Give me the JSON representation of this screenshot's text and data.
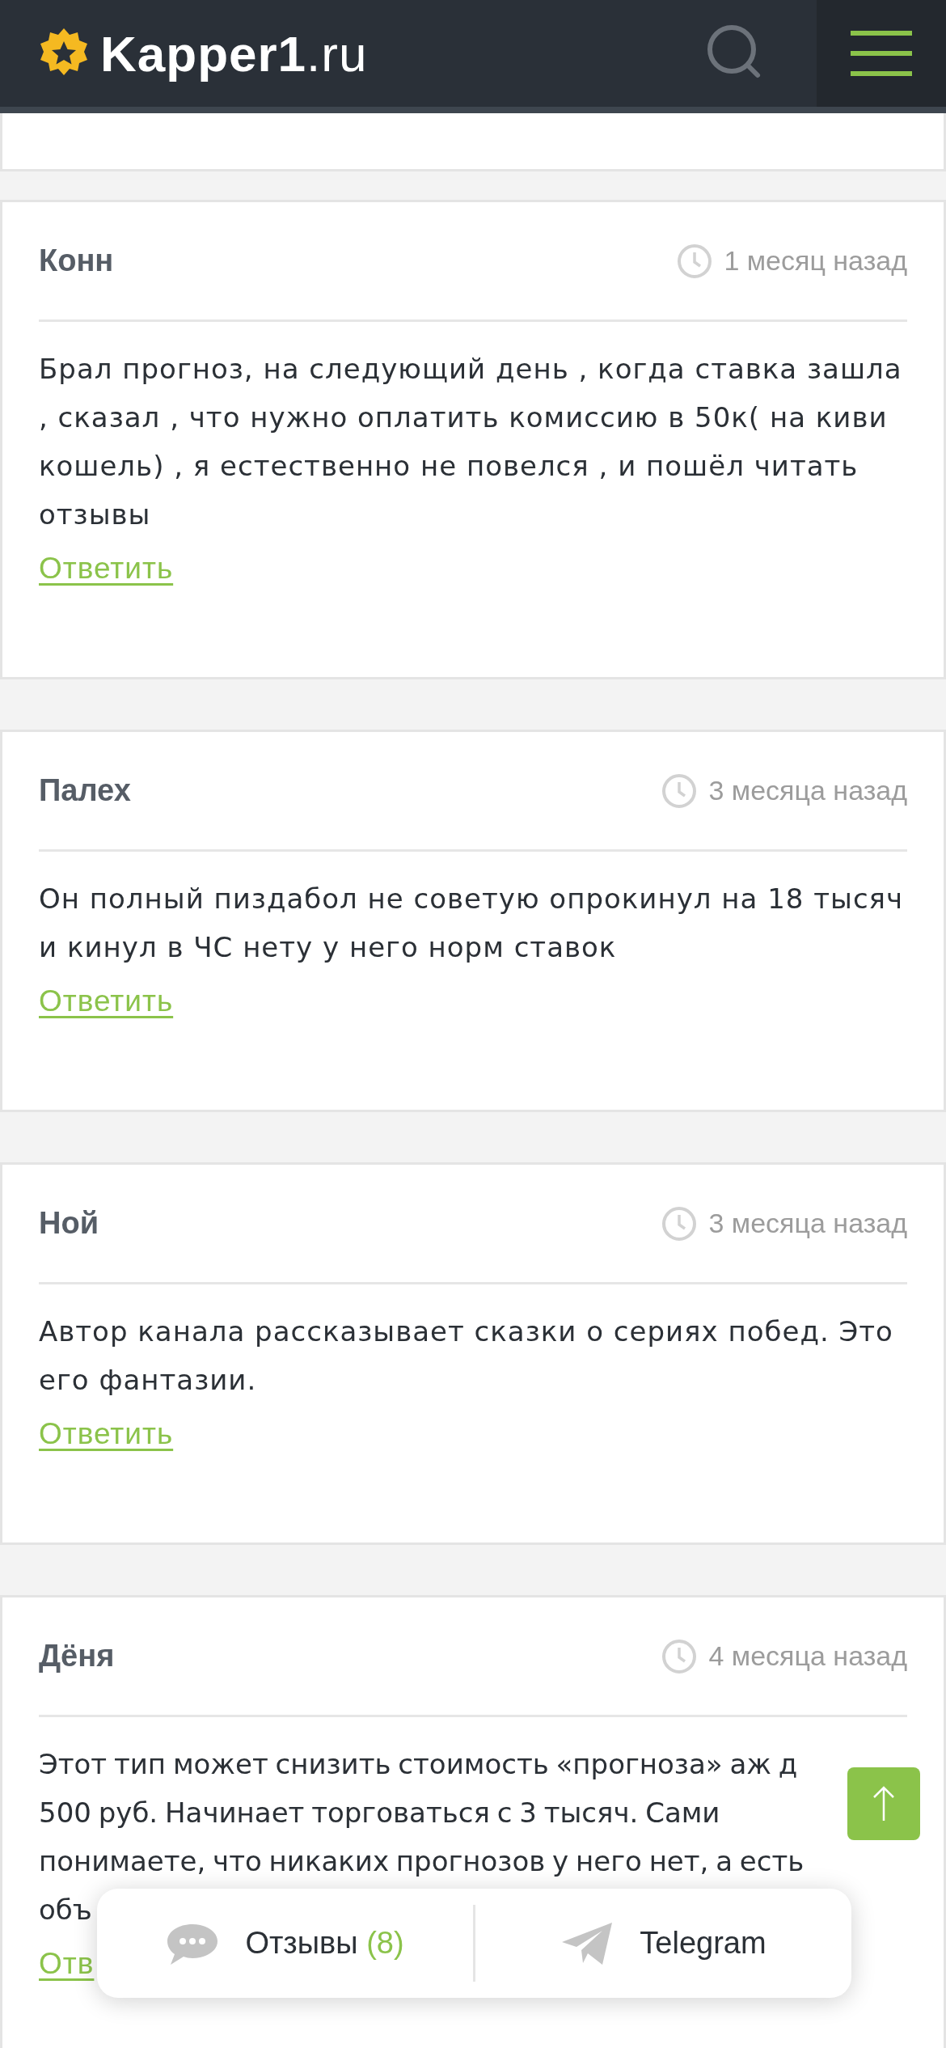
{
  "header": {
    "logo": "**Kapper1**.ru"
  },
  "comments": [
    {
      "kind": "partial"
    },
    {
      "kind": "full",
      "author": "Конн",
      "time": "1 месяц назад",
      "text": "Брал прогноз, на следующий день , когда ставка зашла , сказал , что нужно оплатить комиссию в 50к( на киви кошель) , я естественно не повелся , и пошёл читать отзывы",
      "reply": "Ответить"
    },
    {
      "kind": "full",
      "author": "Палех",
      "time": "3 месяца назад",
      "text": "Он полный пиздабол не советую опрокинул на 18 тысяч и кинул в ЧС нету у него норм ставок",
      "reply": "Ответить"
    },
    {
      "kind": "full",
      "author": "Ной",
      "time": "3 месяца назад",
      "text": "Автор канала рассказывает сказки о сериях побед. Это его фантазии.",
      "reply": "Ответить"
    },
    {
      "kind": "cut",
      "author": "Дёня",
      "time": "4 месяца назад",
      "text": "Этот тип может снизить стоимость «прогноза» аж д 500 руб. Начинает торговаться с 3 тысяч. Сами понимаете, что никаких прогнозов у него нет, а есть объ",
      "reply": "Отв"
    }
  ],
  "bottom_bar": {
    "reviews_label": "Отзывы",
    "reviews_count": "(8)",
    "telegram_label": "Telegram"
  }
}
